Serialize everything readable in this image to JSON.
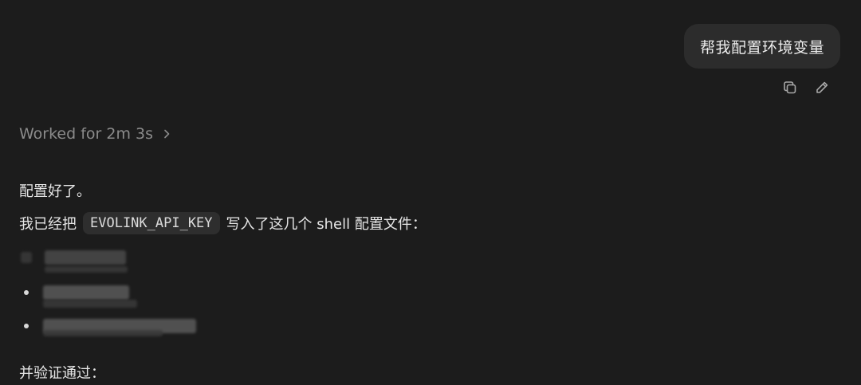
{
  "user_message": {
    "text": "帮我配置环境变量"
  },
  "message_actions": {
    "copy_icon": "copy-icon",
    "edit_icon": "pencil-icon"
  },
  "work_status": {
    "label": "Worked for 2m 3s",
    "expand_icon": "chevron-right-icon"
  },
  "assistant_reply": {
    "line_1": "配置好了。",
    "line_2_prefix": "我已经把",
    "line_2_code": "EVOLINK_API_KEY",
    "line_2_suffix": "写入了这几个 shell 配置文件：",
    "line_3": "并验证通过："
  }
}
